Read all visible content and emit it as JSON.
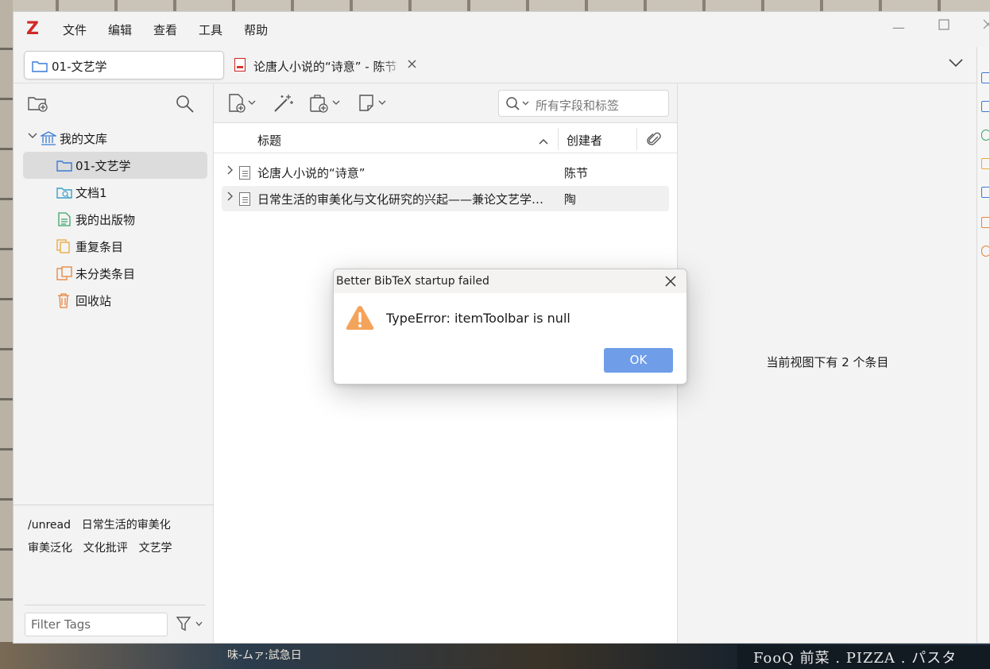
{
  "app": {
    "logo": "Z",
    "menu": [
      "文件",
      "编辑",
      "查看",
      "工具",
      "帮助"
    ],
    "accent_color": "#d32828"
  },
  "tabs": {
    "library_tab": "01-文艺学",
    "document_tab": "论唐人小说的“诗意” - 陈节"
  },
  "collections": {
    "library": "我的文库",
    "items": [
      {
        "label": "01-文艺学",
        "icon": "folder-icon",
        "selected": true
      },
      {
        "label": "文档1",
        "icon": "saved-search-icon",
        "selected": false
      },
      {
        "label": "我的出版物",
        "icon": "publications-icon",
        "selected": false
      },
      {
        "label": "重复条目",
        "icon": "duplicate-icon",
        "selected": false
      },
      {
        "label": "未分类条目",
        "icon": "unfiled-icon",
        "selected": false
      },
      {
        "label": "回收站",
        "icon": "trash-icon",
        "selected": false
      }
    ]
  },
  "tags": [
    "/unread",
    "日常生活的审美化",
    "审美泛化",
    "文化批评",
    "文艺学"
  ],
  "tag_filter": {
    "placeholder": "Filter Tags"
  },
  "search": {
    "placeholder": "所有字段和标签"
  },
  "columns": {
    "title": "标题",
    "creator": "创建者"
  },
  "items": [
    {
      "title": "论唐人小说的“诗意”",
      "creator": "陈节"
    },
    {
      "title": "日常生活的审美化与文化研究的兴起——兼论文艺学的学科反思",
      "creator": "陶"
    }
  ],
  "item_pane": {
    "message": "当前视图下有 2 个条目"
  },
  "dialog": {
    "title": "Better BibTeX startup failed",
    "message": "TypeError: itemToolbar is null",
    "ok_label": "OK",
    "icon": "warning-icon",
    "icon_color": "#f4a35a",
    "button_color": "#6f9de8"
  },
  "background": {
    "sign_text": "FooQ 前菜 . PIZZA . パスタ",
    "chalk_text": "味-ムァ:試急日"
  }
}
